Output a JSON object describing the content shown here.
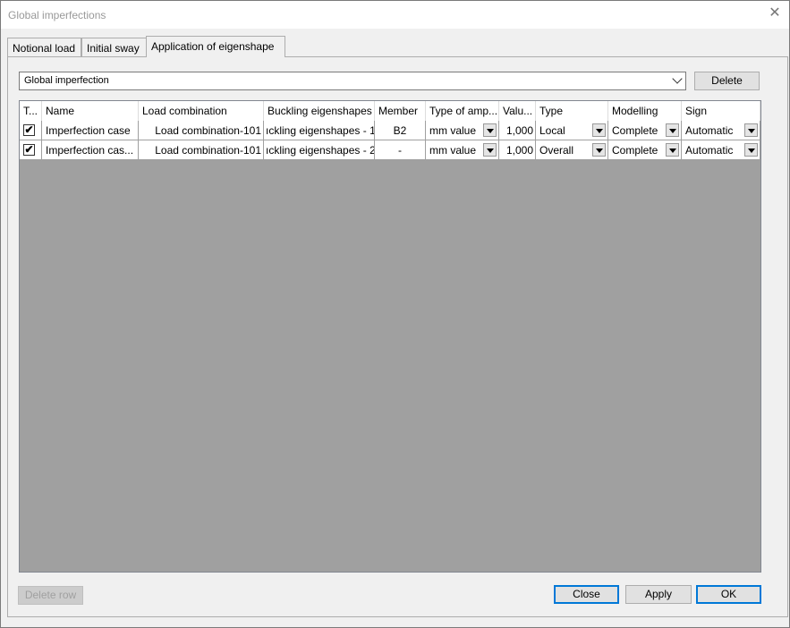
{
  "window": {
    "title": "Global imperfections"
  },
  "tabs": [
    {
      "label": "Notional load"
    },
    {
      "label": "Initial sway"
    },
    {
      "label": "Application of eigenshape"
    }
  ],
  "selector": {
    "value": "Global imperfection",
    "delete_label": "Delete"
  },
  "table": {
    "columns": [
      "T...",
      "Name",
      "Load combination",
      "Buckling eigenshapes",
      "Member",
      "Type of amp...",
      "Valu...",
      "Type",
      "Modelling",
      "Sign"
    ],
    "rows": [
      {
        "checked": "✔",
        "name": "Imperfection case",
        "load_combination": "Load combination-101",
        "buckling": "ıckling eigenshapes - 1",
        "member": "B2",
        "type_amp": "mm value",
        "value": "1,000",
        "type": "Local",
        "modelling": "Complete",
        "sign": "Automatic"
      },
      {
        "checked": "✔",
        "name": "Imperfection cas...",
        "load_combination": "Load combination-101",
        "buckling": "ıckling eigenshapes - 2",
        "member": "-",
        "type_amp": "mm value",
        "value": "1,000",
        "type": "Overall",
        "modelling": "Complete",
        "sign": "Automatic"
      }
    ]
  },
  "buttons": {
    "delete_row": "Delete row",
    "close": "Close",
    "apply": "Apply",
    "ok": "OK"
  }
}
